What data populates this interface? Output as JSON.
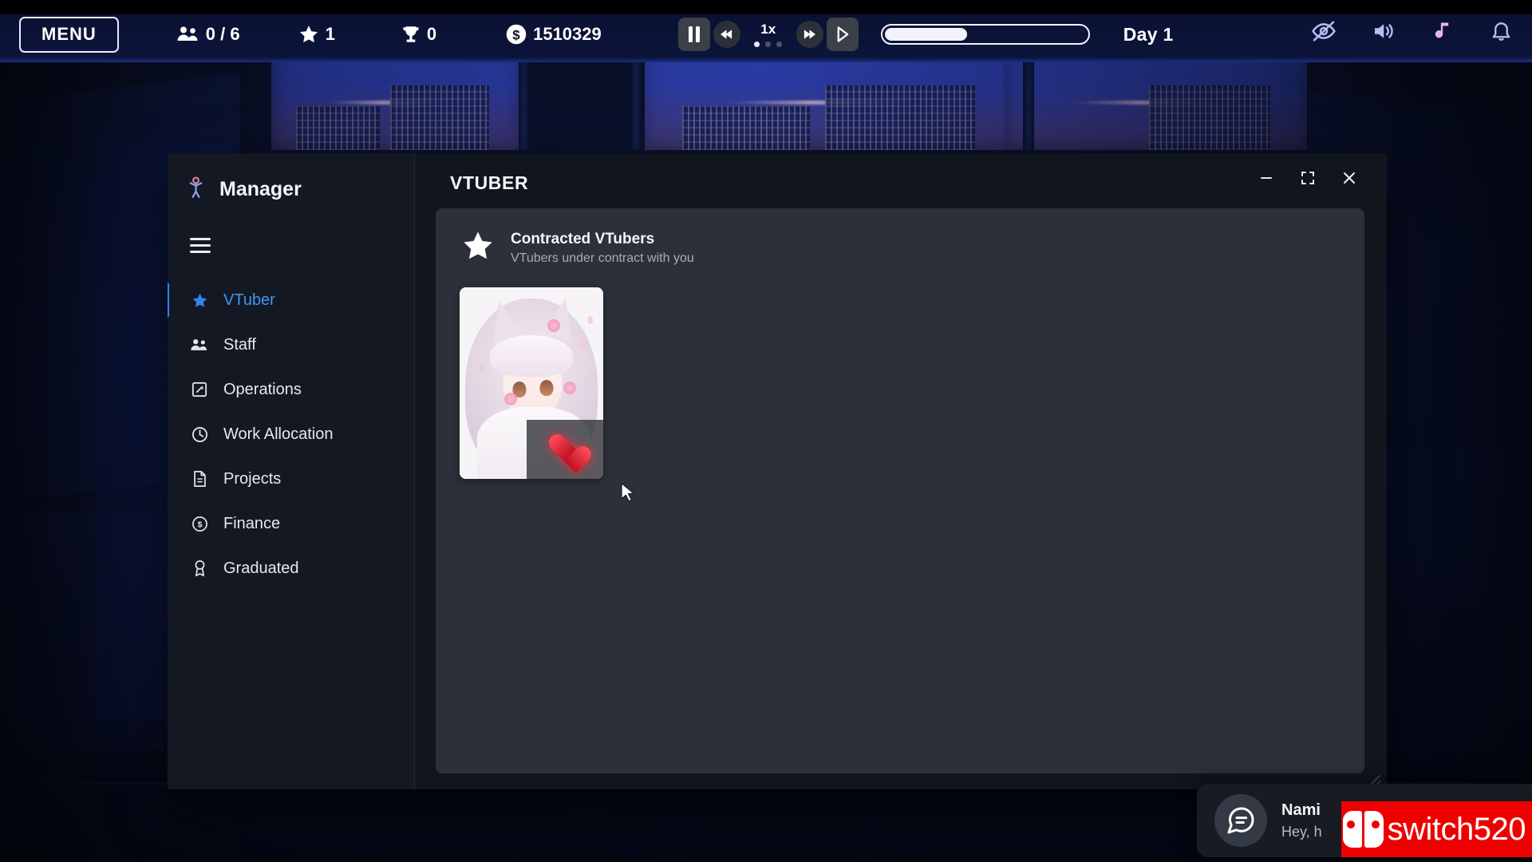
{
  "hud": {
    "menu_label": "MENU",
    "stats": [
      {
        "icon": "people-icon",
        "value": "0 / 6"
      },
      {
        "icon": "star-icon",
        "value": "1"
      },
      {
        "icon": "trophy-icon",
        "value": "0"
      },
      {
        "icon": "money-icon",
        "value": "1510329"
      }
    ],
    "time_controls": {
      "pause_label": "pause-icon",
      "rewind_label": "rewind-icon",
      "speed_label": "1x",
      "speed_dots": 3,
      "speed_active_index": 0,
      "fastforward_label": "fast-forward-icon",
      "play_label": "play-icon"
    },
    "day_progress_percent": 41,
    "day_label": "Day 1",
    "right_icons": [
      "eye-off-icon",
      "volume-icon",
      "music-icon",
      "bell-icon"
    ]
  },
  "window": {
    "sidebar": {
      "brand": "Manager",
      "menu_toggle": "hamburger-icon",
      "items": [
        {
          "label": "VTuber",
          "icon": "star-icon",
          "active": true
        },
        {
          "label": "Staff",
          "icon": "people-icon",
          "active": false
        },
        {
          "label": "Operations",
          "icon": "edit-square-icon",
          "active": false
        },
        {
          "label": "Work Allocation",
          "icon": "clock-icon",
          "active": false
        },
        {
          "label": "Projects",
          "icon": "document-icon",
          "active": false
        },
        {
          "label": "Finance",
          "icon": "coin-icon",
          "active": false
        },
        {
          "label": "Graduated",
          "icon": "award-icon",
          "active": false
        }
      ]
    },
    "title": "VTUBER",
    "controls": {
      "minimize": "minimize-icon",
      "maximize": "maximize-icon",
      "close": "close-icon"
    },
    "section": {
      "icon": "star-icon",
      "heading": "Contracted VTubers",
      "subheading": "VTubers under contract with you"
    },
    "vtubers": [
      {
        "name": "vtuber-portrait-card",
        "badge": "heart-icon"
      }
    ]
  },
  "toast": {
    "icon": "chat-bubble-icon",
    "name": "Nami",
    "message": "Hey, h"
  },
  "watermark": {
    "text": "switch520",
    "icon": "nintendo-switch-icon",
    "color": "#ee0000"
  },
  "colors": {
    "accent": "#2f86ec",
    "panel": "#11151d",
    "sidebar": "#141823",
    "card": "#2c3038",
    "text": "#f2f5fb"
  }
}
